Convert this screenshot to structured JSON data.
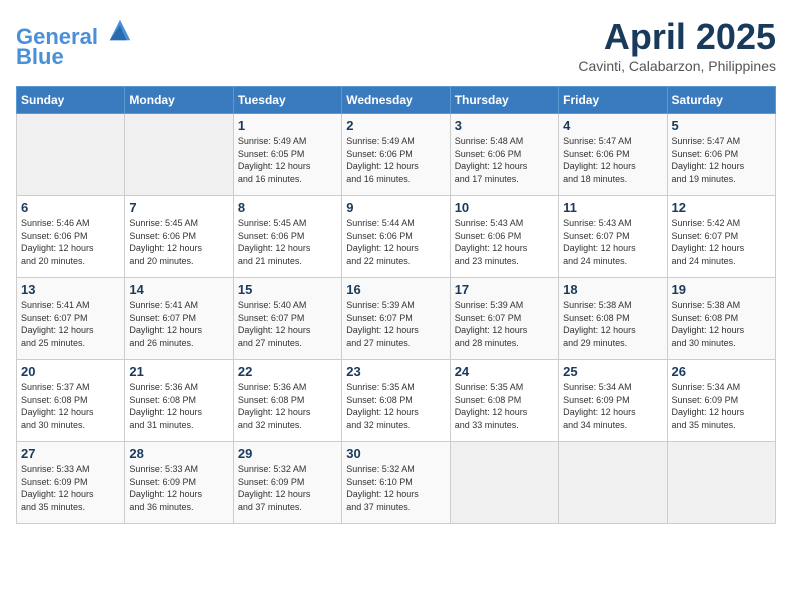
{
  "logo": {
    "line1": "General",
    "line2": "Blue"
  },
  "title": "April 2025",
  "subtitle": "Cavinti, Calabarzon, Philippines",
  "days_header": [
    "Sunday",
    "Monday",
    "Tuesday",
    "Wednesday",
    "Thursday",
    "Friday",
    "Saturday"
  ],
  "weeks": [
    [
      {
        "day": "",
        "info": ""
      },
      {
        "day": "",
        "info": ""
      },
      {
        "day": "1",
        "info": "Sunrise: 5:49 AM\nSunset: 6:05 PM\nDaylight: 12 hours\nand 16 minutes."
      },
      {
        "day": "2",
        "info": "Sunrise: 5:49 AM\nSunset: 6:06 PM\nDaylight: 12 hours\nand 16 minutes."
      },
      {
        "day": "3",
        "info": "Sunrise: 5:48 AM\nSunset: 6:06 PM\nDaylight: 12 hours\nand 17 minutes."
      },
      {
        "day": "4",
        "info": "Sunrise: 5:47 AM\nSunset: 6:06 PM\nDaylight: 12 hours\nand 18 minutes."
      },
      {
        "day": "5",
        "info": "Sunrise: 5:47 AM\nSunset: 6:06 PM\nDaylight: 12 hours\nand 19 minutes."
      }
    ],
    [
      {
        "day": "6",
        "info": "Sunrise: 5:46 AM\nSunset: 6:06 PM\nDaylight: 12 hours\nand 20 minutes."
      },
      {
        "day": "7",
        "info": "Sunrise: 5:45 AM\nSunset: 6:06 PM\nDaylight: 12 hours\nand 20 minutes."
      },
      {
        "day": "8",
        "info": "Sunrise: 5:45 AM\nSunset: 6:06 PM\nDaylight: 12 hours\nand 21 minutes."
      },
      {
        "day": "9",
        "info": "Sunrise: 5:44 AM\nSunset: 6:06 PM\nDaylight: 12 hours\nand 22 minutes."
      },
      {
        "day": "10",
        "info": "Sunrise: 5:43 AM\nSunset: 6:06 PM\nDaylight: 12 hours\nand 23 minutes."
      },
      {
        "day": "11",
        "info": "Sunrise: 5:43 AM\nSunset: 6:07 PM\nDaylight: 12 hours\nand 24 minutes."
      },
      {
        "day": "12",
        "info": "Sunrise: 5:42 AM\nSunset: 6:07 PM\nDaylight: 12 hours\nand 24 minutes."
      }
    ],
    [
      {
        "day": "13",
        "info": "Sunrise: 5:41 AM\nSunset: 6:07 PM\nDaylight: 12 hours\nand 25 minutes."
      },
      {
        "day": "14",
        "info": "Sunrise: 5:41 AM\nSunset: 6:07 PM\nDaylight: 12 hours\nand 26 minutes."
      },
      {
        "day": "15",
        "info": "Sunrise: 5:40 AM\nSunset: 6:07 PM\nDaylight: 12 hours\nand 27 minutes."
      },
      {
        "day": "16",
        "info": "Sunrise: 5:39 AM\nSunset: 6:07 PM\nDaylight: 12 hours\nand 27 minutes."
      },
      {
        "day": "17",
        "info": "Sunrise: 5:39 AM\nSunset: 6:07 PM\nDaylight: 12 hours\nand 28 minutes."
      },
      {
        "day": "18",
        "info": "Sunrise: 5:38 AM\nSunset: 6:08 PM\nDaylight: 12 hours\nand 29 minutes."
      },
      {
        "day": "19",
        "info": "Sunrise: 5:38 AM\nSunset: 6:08 PM\nDaylight: 12 hours\nand 30 minutes."
      }
    ],
    [
      {
        "day": "20",
        "info": "Sunrise: 5:37 AM\nSunset: 6:08 PM\nDaylight: 12 hours\nand 30 minutes."
      },
      {
        "day": "21",
        "info": "Sunrise: 5:36 AM\nSunset: 6:08 PM\nDaylight: 12 hours\nand 31 minutes."
      },
      {
        "day": "22",
        "info": "Sunrise: 5:36 AM\nSunset: 6:08 PM\nDaylight: 12 hours\nand 32 minutes."
      },
      {
        "day": "23",
        "info": "Sunrise: 5:35 AM\nSunset: 6:08 PM\nDaylight: 12 hours\nand 32 minutes."
      },
      {
        "day": "24",
        "info": "Sunrise: 5:35 AM\nSunset: 6:08 PM\nDaylight: 12 hours\nand 33 minutes."
      },
      {
        "day": "25",
        "info": "Sunrise: 5:34 AM\nSunset: 6:09 PM\nDaylight: 12 hours\nand 34 minutes."
      },
      {
        "day": "26",
        "info": "Sunrise: 5:34 AM\nSunset: 6:09 PM\nDaylight: 12 hours\nand 35 minutes."
      }
    ],
    [
      {
        "day": "27",
        "info": "Sunrise: 5:33 AM\nSunset: 6:09 PM\nDaylight: 12 hours\nand 35 minutes."
      },
      {
        "day": "28",
        "info": "Sunrise: 5:33 AM\nSunset: 6:09 PM\nDaylight: 12 hours\nand 36 minutes."
      },
      {
        "day": "29",
        "info": "Sunrise: 5:32 AM\nSunset: 6:09 PM\nDaylight: 12 hours\nand 37 minutes."
      },
      {
        "day": "30",
        "info": "Sunrise: 5:32 AM\nSunset: 6:10 PM\nDaylight: 12 hours\nand 37 minutes."
      },
      {
        "day": "",
        "info": ""
      },
      {
        "day": "",
        "info": ""
      },
      {
        "day": "",
        "info": ""
      }
    ]
  ]
}
